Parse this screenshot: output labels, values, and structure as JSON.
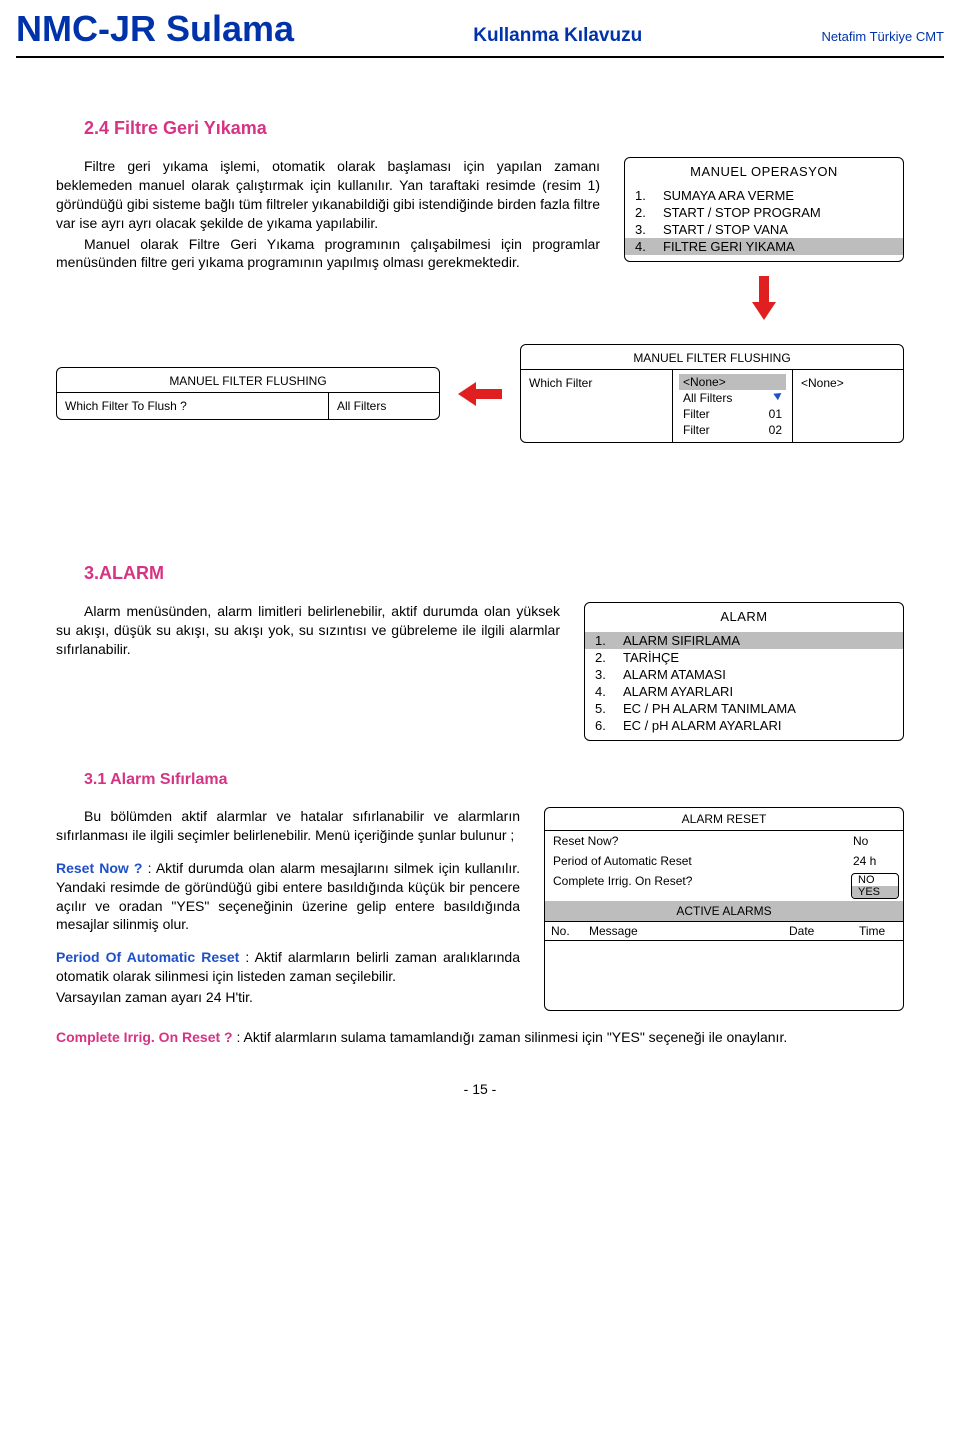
{
  "header": {
    "title": "NMC-JR Sulama",
    "subtitle": "Kullanma Kılavuzu",
    "right": "Netafim Türkiye CMT"
  },
  "s24": {
    "heading": "2.4    Filtre  Geri Yıkama",
    "p1": "Filtre geri yıkama işlemi, otomatik olarak başlaması için yapılan zamanı beklemeden manuel olarak çalıştırmak için kullanılır. Yan taraftaki resimde (resim 1) göründüğü gibi sisteme bağlı tüm filtreler yıkanabildiği gibi istendiğinde birden fazla filtre var ise ayrı ayrı olacak şekilde de yıkama yapılabilir.",
    "p2": "Manuel olarak Filtre Geri Yıkama programının çalışabilmesi için programlar menüsünden filtre geri yıkama programının yapılmış olması gerekmektedir."
  },
  "manuelOp": {
    "title": "MANUEL OPERASYON",
    "items": [
      {
        "n": "1.",
        "t": "SUMAYA  ARA  VERME"
      },
      {
        "n": "2.",
        "t": "START / STOP PROGRAM"
      },
      {
        "n": "3.",
        "t": "START / STOP  VANA"
      },
      {
        "n": "4.",
        "t": "FILTRE  GERI  YIKAMA"
      }
    ]
  },
  "filterLeft": {
    "title": "MANUEL  FILTER  FLUSHING",
    "label": "Which  Filter  To  Flush ?",
    "value": "All  Filters"
  },
  "filterRight": {
    "title": "MANUEL   FILTER   FLUSHING",
    "label": "Which  Filter",
    "rightVal": "<None>",
    "options": [
      {
        "l": "<None>",
        "r": ""
      },
      {
        "l": "All  Filters",
        "r": ""
      },
      {
        "l": "Filter",
        "r": "01"
      },
      {
        "l": "Filter",
        "r": "02"
      }
    ]
  },
  "s3": {
    "heading": "3.ALARM",
    "p": "Alarm menüsünden, alarm limitleri belirlenebilir, aktif durumda olan yüksek su akışı, düşük su akışı, su akışı yok, su sızıntısı ve gübreleme ile ilgili alarmlar sıfırlanabilir."
  },
  "alarmMenu": {
    "title": "ALARM",
    "items": [
      {
        "n": "1.",
        "t": "ALARM  SIFIRLAMA"
      },
      {
        "n": "2.",
        "t": "TARİHÇE"
      },
      {
        "n": "3.",
        "t": "ALARM   ATAMASI"
      },
      {
        "n": "4.",
        "t": "ALARM    AYARLARI"
      },
      {
        "n": "5.",
        "t": "EC / PH  ALARM  TANIMLAMA"
      },
      {
        "n": "6.",
        "t": "EC / pH  ALARM  AYARLARI"
      }
    ]
  },
  "s31": {
    "heading": "3.1     Alarm Sıfırlama",
    "p1": "Bu   bölümden   aktif   alarmlar   ve   hatalar sıfırlanabilir ve alarmların sıfırlanması ile ilgili seçimler belirlenebilir. Menü içeriğinde şunlar bulunur ;",
    "resetLabel": "Reset Now ?",
    "resetText": "   :  Aktif durumda olan alarm mesajlarını silmek için kullanılır. Yandaki resimde de göründüğü gibi entere basıldığında küçük bir pencere açılır ve oradan \"YES\" seçeneğinin üzerine gelip entere basıldığında mesajlar silinmiş olur.",
    "periodLabel": "Period Of Automatic Reset",
    "periodText": "   : Aktif alarmların belirli zaman aralıklarında otomatik olarak silinmesi için listeden zaman seçilebilir.",
    "defaultLine": "Varsayılan zaman ayarı 24 H'tir.",
    "completeLabel": "Complete Irrig. On Reset ?",
    "completeText": "    :  Aktif alarmların sulama tamamlandığı zaman silinmesi için \"YES\" seçeneği ile onaylanır."
  },
  "resetPanel": {
    "title": "ALARM   RESET",
    "rows": [
      {
        "label": "Reset   Now?",
        "val": "No"
      },
      {
        "label": "Period   of   Automatic   Reset",
        "val": "24 h"
      },
      {
        "label": "Complete Irrig.  On  Reset?",
        "choices": [
          "NO",
          "YES"
        ]
      }
    ],
    "activeTitle": "ACTIVE   ALARMS",
    "cols": [
      "No.",
      "Message",
      "Date",
      "Time"
    ]
  },
  "pageNum": "- 15 -"
}
